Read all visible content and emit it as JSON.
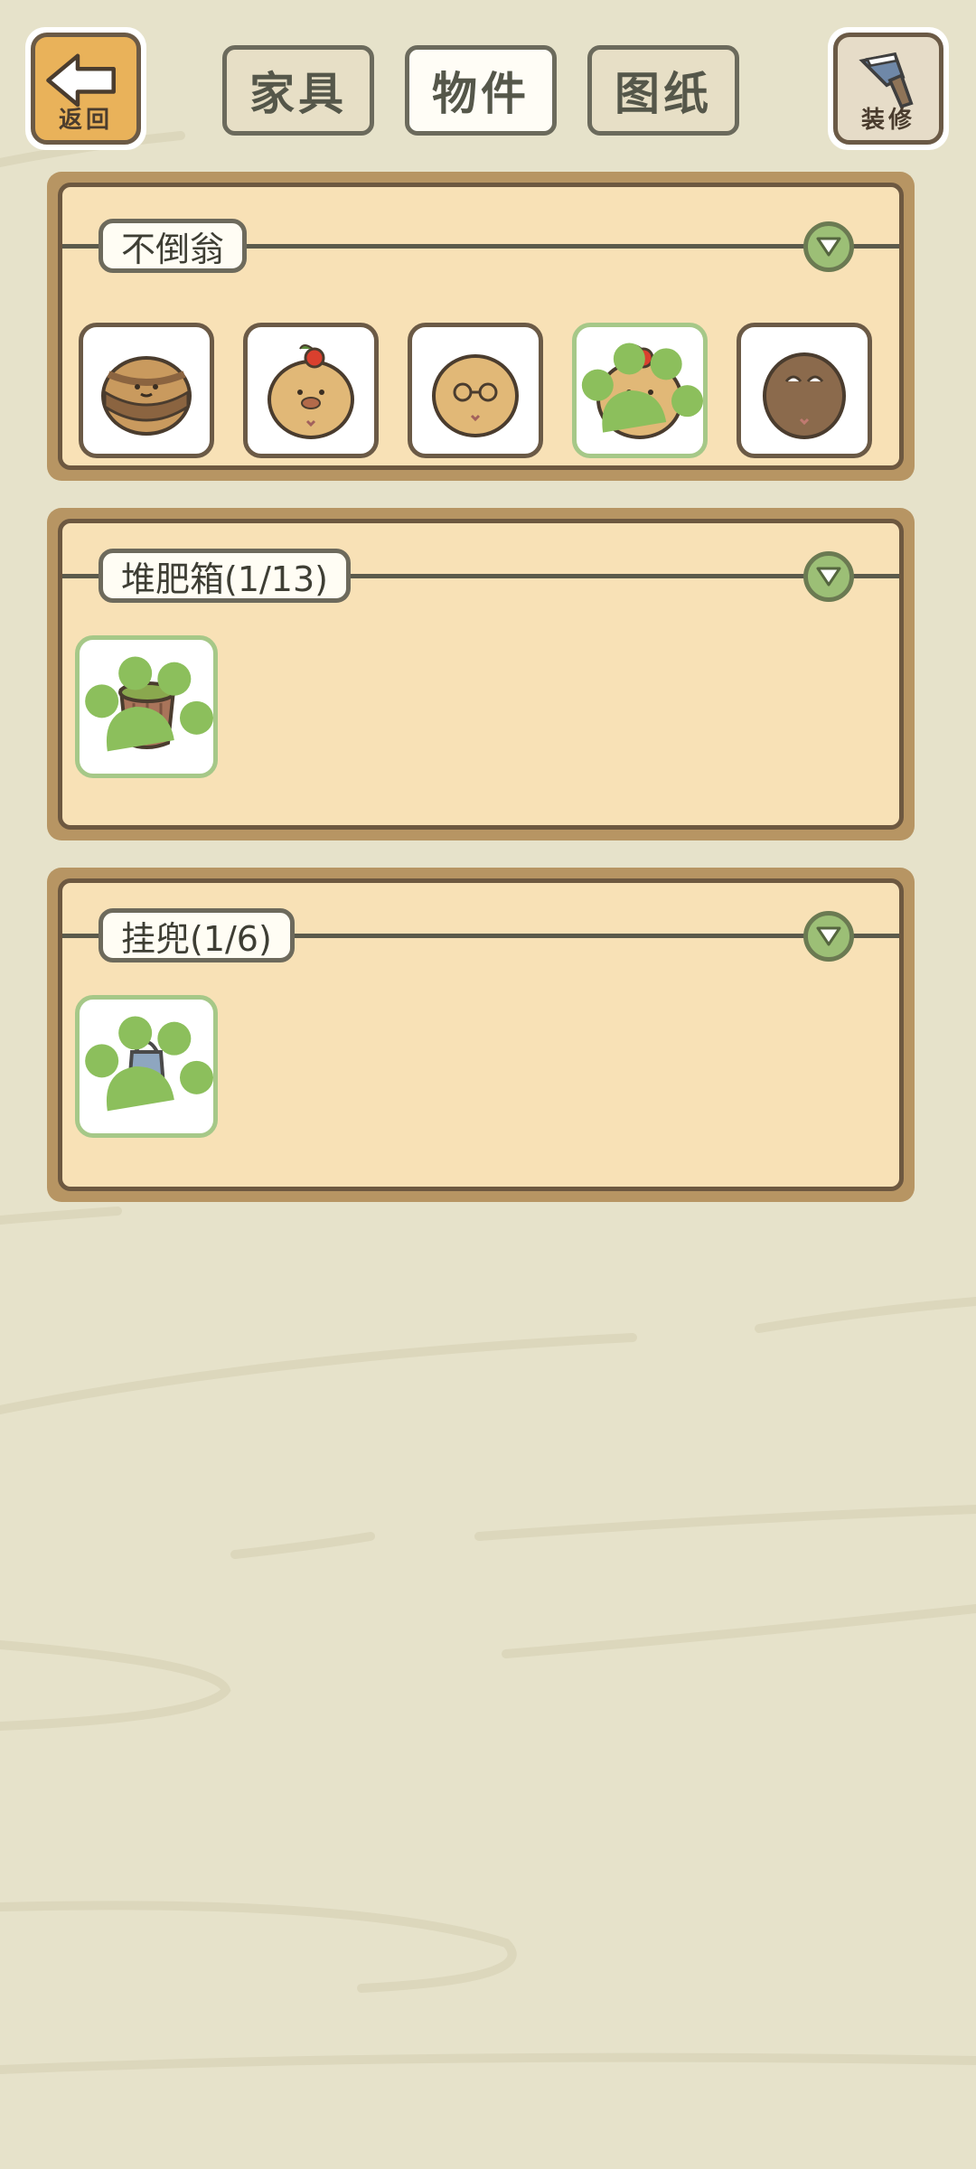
{
  "top_bar": {
    "back_label": "返回",
    "decorate_label": "装修",
    "tabs": [
      {
        "label": "家具",
        "active": false
      },
      {
        "label": "物件",
        "active": true
      },
      {
        "label": "图纸",
        "active": false
      }
    ]
  },
  "sections": [
    {
      "title": "不倒翁",
      "items": [
        {
          "icon": "brown-tumbler-icon",
          "owned": false
        },
        {
          "icon": "apple-tumbler-icon",
          "owned": false
        },
        {
          "icon": "glasses-tumbler-icon",
          "owned": false
        },
        {
          "icon": "apple-tumbler-icon",
          "owned": true
        },
        {
          "icon": "dark-tumbler-icon",
          "owned": false
        }
      ]
    },
    {
      "title": "堆肥箱(1/13)",
      "items": [
        {
          "icon": "compost-bucket-icon",
          "owned": true
        }
      ]
    },
    {
      "title": "挂兜(1/6)",
      "items": [
        {
          "icon": "hanging-pouch-icon",
          "owned": true
        }
      ]
    }
  ],
  "colors": {
    "background": "#e6e2ca",
    "panel_fill": "#f8e1b6",
    "panel_frame": "#b79563",
    "owned_border": "#a6c888",
    "toggle": "#9cbf76"
  }
}
